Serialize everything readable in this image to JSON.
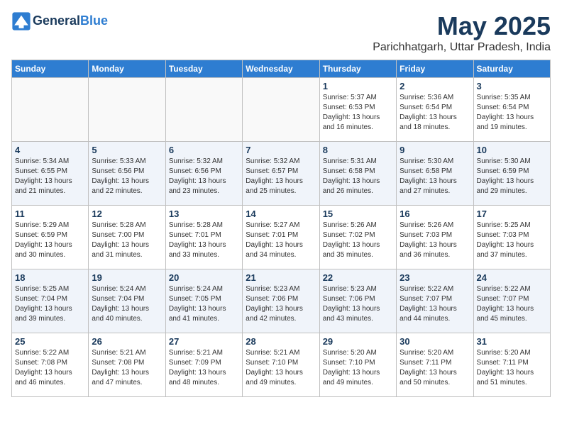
{
  "header": {
    "logo_line1": "General",
    "logo_line2": "Blue",
    "month": "May 2025",
    "location": "Parichhatgarh, Uttar Pradesh, India"
  },
  "weekdays": [
    "Sunday",
    "Monday",
    "Tuesday",
    "Wednesday",
    "Thursday",
    "Friday",
    "Saturday"
  ],
  "weeks": [
    [
      {
        "day": "",
        "text": ""
      },
      {
        "day": "",
        "text": ""
      },
      {
        "day": "",
        "text": ""
      },
      {
        "day": "",
        "text": ""
      },
      {
        "day": "1",
        "text": "Sunrise: 5:37 AM\nSunset: 6:53 PM\nDaylight: 13 hours\nand 16 minutes."
      },
      {
        "day": "2",
        "text": "Sunrise: 5:36 AM\nSunset: 6:54 PM\nDaylight: 13 hours\nand 18 minutes."
      },
      {
        "day": "3",
        "text": "Sunrise: 5:35 AM\nSunset: 6:54 PM\nDaylight: 13 hours\nand 19 minutes."
      }
    ],
    [
      {
        "day": "4",
        "text": "Sunrise: 5:34 AM\nSunset: 6:55 PM\nDaylight: 13 hours\nand 21 minutes."
      },
      {
        "day": "5",
        "text": "Sunrise: 5:33 AM\nSunset: 6:56 PM\nDaylight: 13 hours\nand 22 minutes."
      },
      {
        "day": "6",
        "text": "Sunrise: 5:32 AM\nSunset: 6:56 PM\nDaylight: 13 hours\nand 23 minutes."
      },
      {
        "day": "7",
        "text": "Sunrise: 5:32 AM\nSunset: 6:57 PM\nDaylight: 13 hours\nand 25 minutes."
      },
      {
        "day": "8",
        "text": "Sunrise: 5:31 AM\nSunset: 6:58 PM\nDaylight: 13 hours\nand 26 minutes."
      },
      {
        "day": "9",
        "text": "Sunrise: 5:30 AM\nSunset: 6:58 PM\nDaylight: 13 hours\nand 27 minutes."
      },
      {
        "day": "10",
        "text": "Sunrise: 5:30 AM\nSunset: 6:59 PM\nDaylight: 13 hours\nand 29 minutes."
      }
    ],
    [
      {
        "day": "11",
        "text": "Sunrise: 5:29 AM\nSunset: 6:59 PM\nDaylight: 13 hours\nand 30 minutes."
      },
      {
        "day": "12",
        "text": "Sunrise: 5:28 AM\nSunset: 7:00 PM\nDaylight: 13 hours\nand 31 minutes."
      },
      {
        "day": "13",
        "text": "Sunrise: 5:28 AM\nSunset: 7:01 PM\nDaylight: 13 hours\nand 33 minutes."
      },
      {
        "day": "14",
        "text": "Sunrise: 5:27 AM\nSunset: 7:01 PM\nDaylight: 13 hours\nand 34 minutes."
      },
      {
        "day": "15",
        "text": "Sunrise: 5:26 AM\nSunset: 7:02 PM\nDaylight: 13 hours\nand 35 minutes."
      },
      {
        "day": "16",
        "text": "Sunrise: 5:26 AM\nSunset: 7:03 PM\nDaylight: 13 hours\nand 36 minutes."
      },
      {
        "day": "17",
        "text": "Sunrise: 5:25 AM\nSunset: 7:03 PM\nDaylight: 13 hours\nand 37 minutes."
      }
    ],
    [
      {
        "day": "18",
        "text": "Sunrise: 5:25 AM\nSunset: 7:04 PM\nDaylight: 13 hours\nand 39 minutes."
      },
      {
        "day": "19",
        "text": "Sunrise: 5:24 AM\nSunset: 7:04 PM\nDaylight: 13 hours\nand 40 minutes."
      },
      {
        "day": "20",
        "text": "Sunrise: 5:24 AM\nSunset: 7:05 PM\nDaylight: 13 hours\nand 41 minutes."
      },
      {
        "day": "21",
        "text": "Sunrise: 5:23 AM\nSunset: 7:06 PM\nDaylight: 13 hours\nand 42 minutes."
      },
      {
        "day": "22",
        "text": "Sunrise: 5:23 AM\nSunset: 7:06 PM\nDaylight: 13 hours\nand 43 minutes."
      },
      {
        "day": "23",
        "text": "Sunrise: 5:22 AM\nSunset: 7:07 PM\nDaylight: 13 hours\nand 44 minutes."
      },
      {
        "day": "24",
        "text": "Sunrise: 5:22 AM\nSunset: 7:07 PM\nDaylight: 13 hours\nand 45 minutes."
      }
    ],
    [
      {
        "day": "25",
        "text": "Sunrise: 5:22 AM\nSunset: 7:08 PM\nDaylight: 13 hours\nand 46 minutes."
      },
      {
        "day": "26",
        "text": "Sunrise: 5:21 AM\nSunset: 7:08 PM\nDaylight: 13 hours\nand 47 minutes."
      },
      {
        "day": "27",
        "text": "Sunrise: 5:21 AM\nSunset: 7:09 PM\nDaylight: 13 hours\nand 48 minutes."
      },
      {
        "day": "28",
        "text": "Sunrise: 5:21 AM\nSunset: 7:10 PM\nDaylight: 13 hours\nand 49 minutes."
      },
      {
        "day": "29",
        "text": "Sunrise: 5:20 AM\nSunset: 7:10 PM\nDaylight: 13 hours\nand 49 minutes."
      },
      {
        "day": "30",
        "text": "Sunrise: 5:20 AM\nSunset: 7:11 PM\nDaylight: 13 hours\nand 50 minutes."
      },
      {
        "day": "31",
        "text": "Sunrise: 5:20 AM\nSunset: 7:11 PM\nDaylight: 13 hours\nand 51 minutes."
      }
    ]
  ]
}
